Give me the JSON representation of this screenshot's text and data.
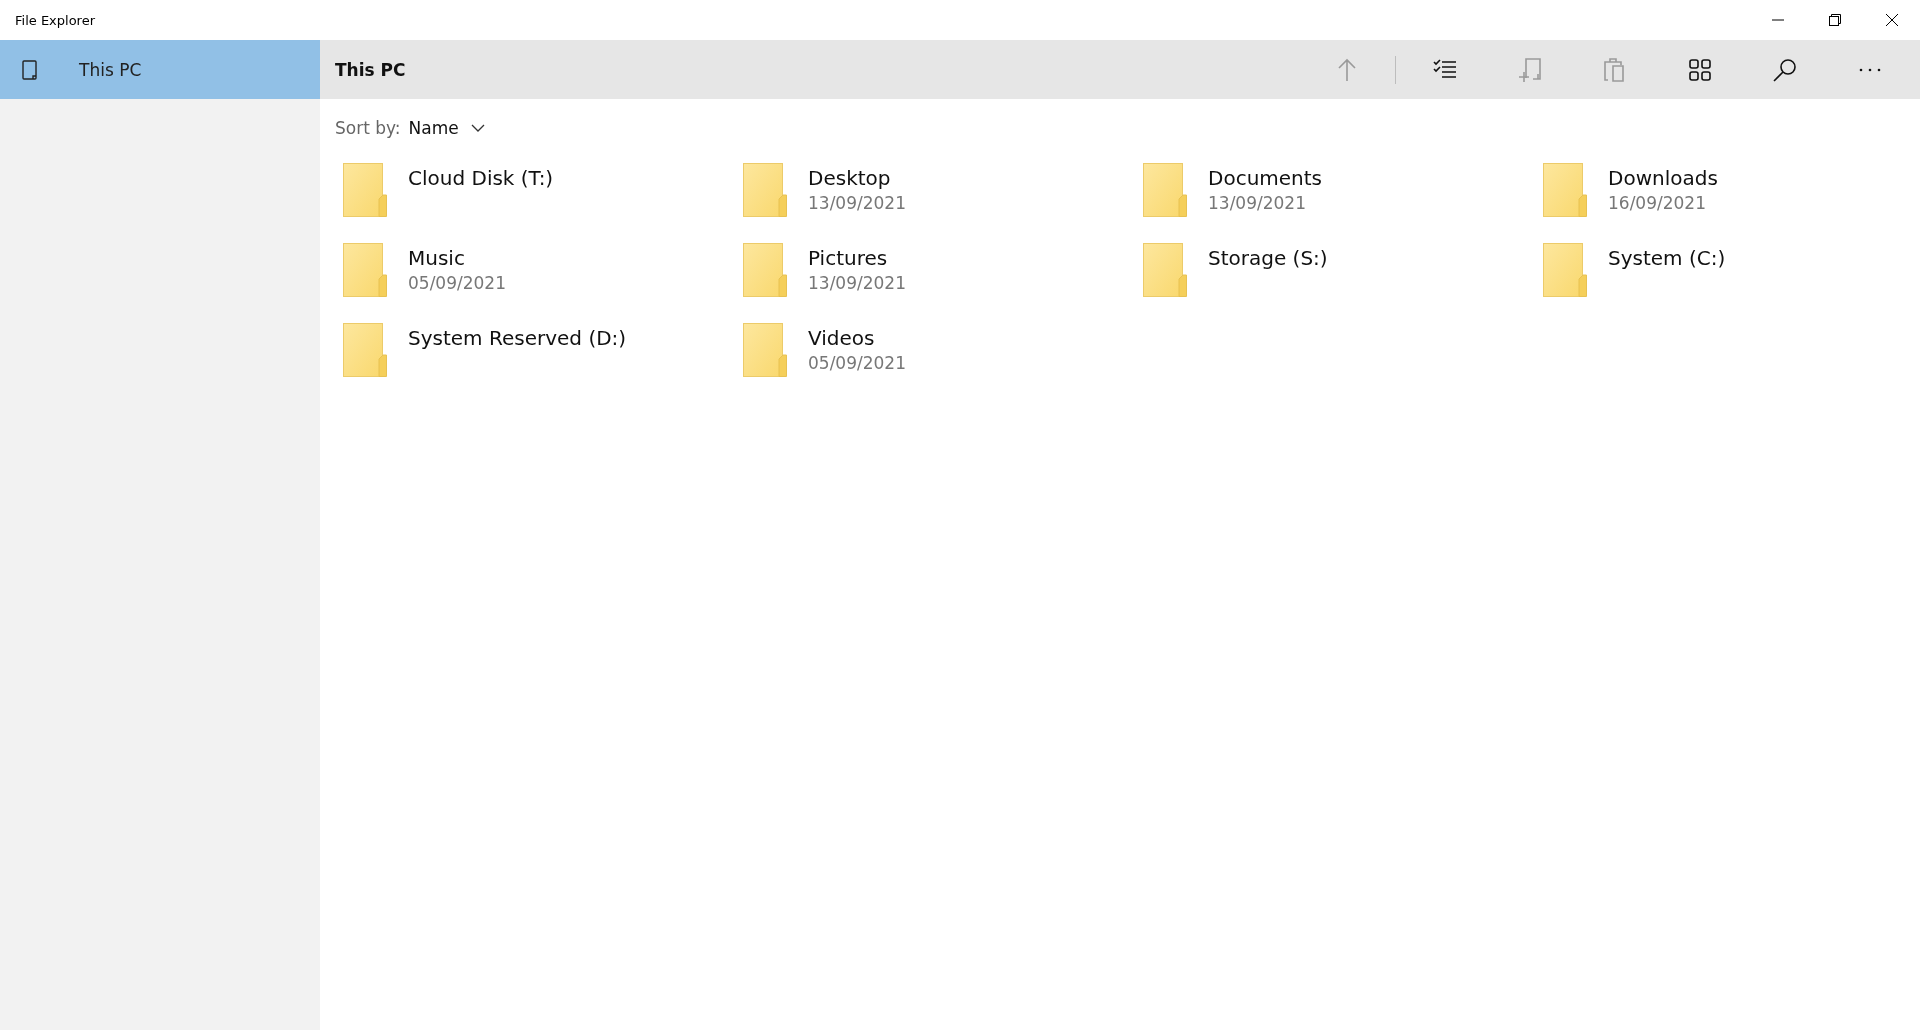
{
  "window": {
    "title": "File Explorer"
  },
  "sidebar": {
    "items": [
      {
        "label": "This PC",
        "selected": true
      }
    ]
  },
  "header": {
    "title": "This PC"
  },
  "toolbar": [
    {
      "kind": "up",
      "disabled": true
    },
    {
      "kind": "separator"
    },
    {
      "kind": "select",
      "disabled": false
    },
    {
      "kind": "new",
      "disabled": true
    },
    {
      "kind": "paste",
      "disabled": true
    },
    {
      "kind": "view",
      "disabled": false
    },
    {
      "kind": "search",
      "disabled": false
    },
    {
      "kind": "more",
      "disabled": false
    }
  ],
  "sort": {
    "label": "Sort by:",
    "value": "Name"
  },
  "items": [
    {
      "name": "Cloud Disk (T:)"
    },
    {
      "name": "Desktop",
      "date": "13/09/2021"
    },
    {
      "name": "Documents",
      "date": "13/09/2021"
    },
    {
      "name": "Downloads",
      "date": "16/09/2021"
    },
    {
      "name": "Music",
      "date": "05/09/2021"
    },
    {
      "name": "Pictures",
      "date": "13/09/2021"
    },
    {
      "name": "Storage (S:)"
    },
    {
      "name": "System (C:)"
    },
    {
      "name": "System Reserved (D:)"
    },
    {
      "name": "Videos",
      "date": "05/09/2021"
    }
  ]
}
